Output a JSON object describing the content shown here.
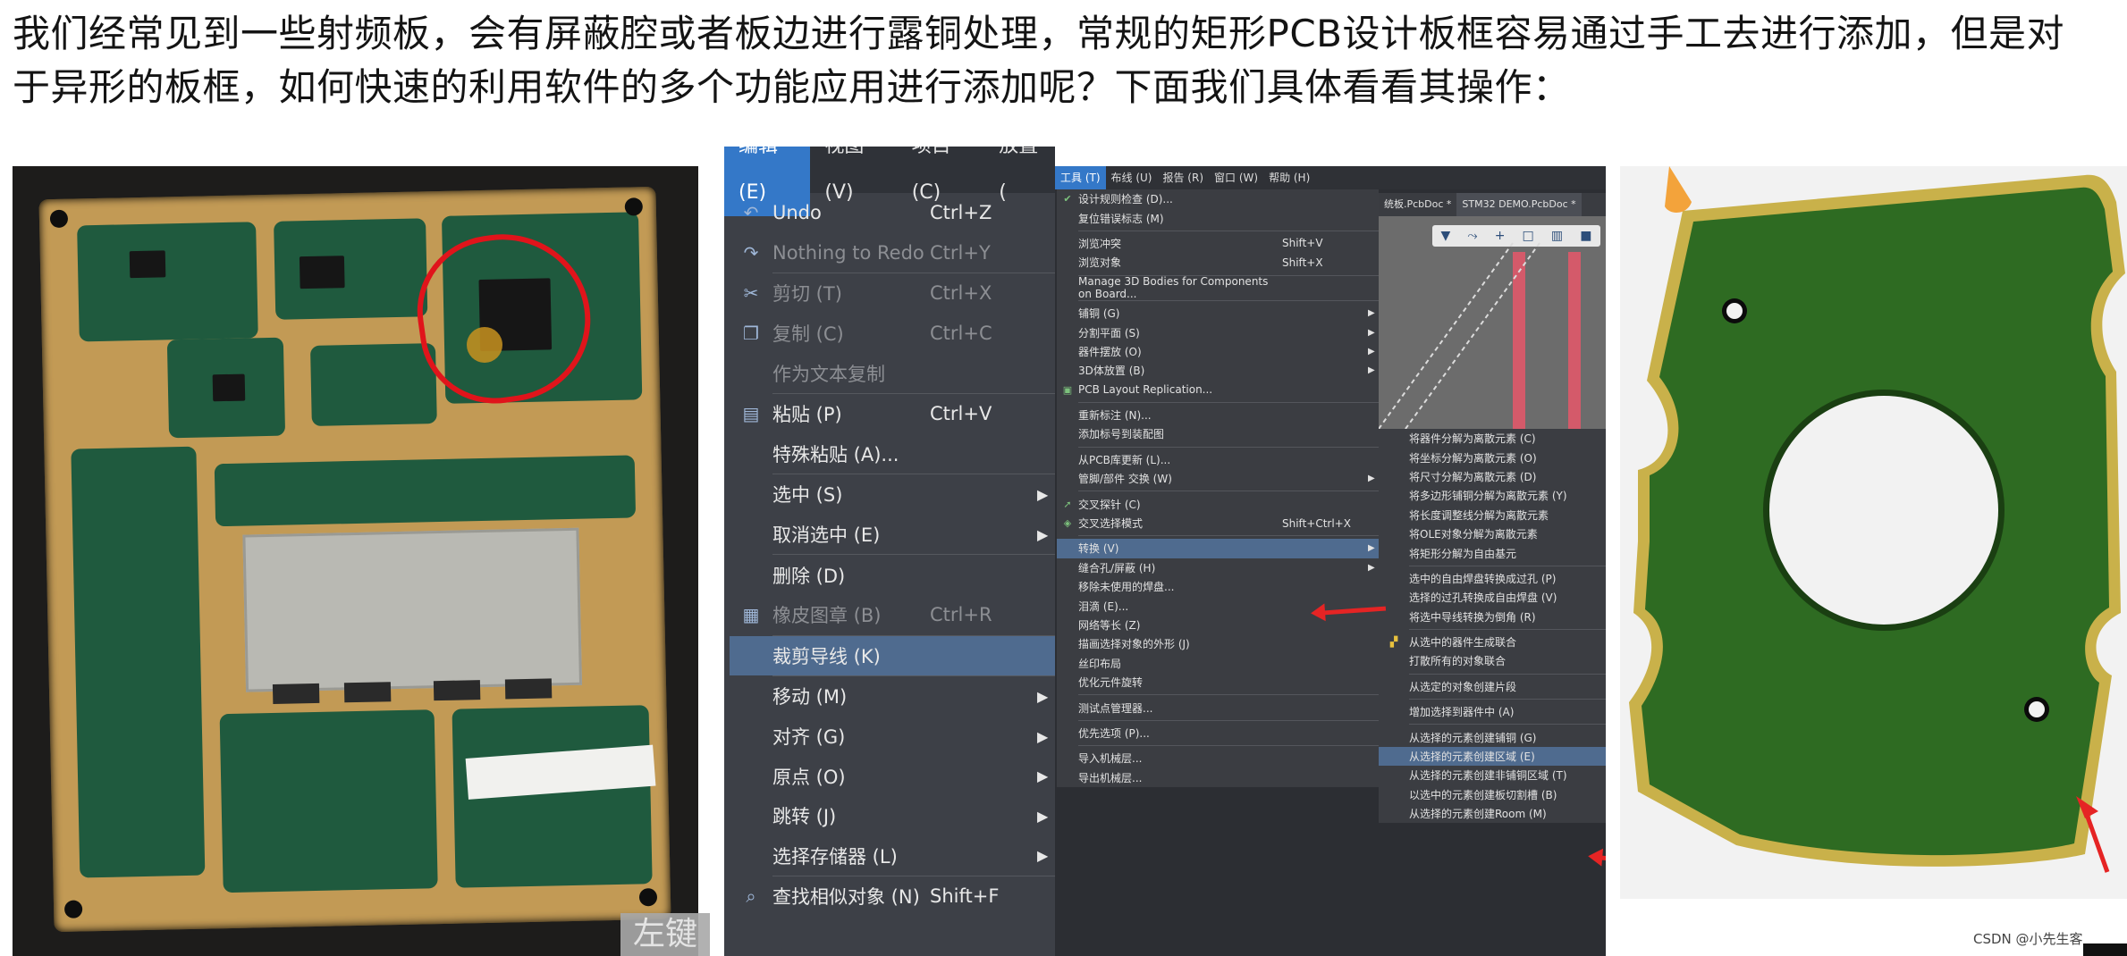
{
  "intro": {
    "line1": "我们经常见到一些射频板，会有屏蔽腔或者板边进行露铜处理，常规的矩形PCB设计板框容易通过手工去进行添加，但是对",
    "line2": "于异形的板框，如何快速的利用软件的多个功能应用进行添加呢？下面我们具体看看其操作："
  },
  "photo": {
    "watermark_button": "左键"
  },
  "edit_menu": {
    "menubar": [
      "编辑 (E)",
      "视图 (V)",
      "项目 (C)",
      "放置 ("
    ],
    "items": [
      {
        "icon": "undo-icon",
        "label": "Undo",
        "shortcut": "Ctrl+Z",
        "disabled": false
      },
      {
        "icon": "redo-icon",
        "label": "Nothing to Redo",
        "shortcut": "Ctrl+Y",
        "disabled": true
      },
      {
        "icon": "cut-icon",
        "label": "剪切 (T)",
        "shortcut": "Ctrl+X",
        "disabled": true
      },
      {
        "icon": "copy-icon",
        "label": "复制 (C)",
        "shortcut": "Ctrl+C",
        "disabled": true
      },
      {
        "icon": "",
        "label": "作为文本复制",
        "shortcut": "",
        "disabled": true
      },
      {
        "icon": "paste-icon",
        "label": "粘贴 (P)",
        "shortcut": "Ctrl+V",
        "disabled": false
      },
      {
        "icon": "",
        "label": "特殊粘贴 (A)...",
        "shortcut": "",
        "disabled": false
      },
      {
        "icon": "",
        "label": "选中 (S)",
        "shortcut": "",
        "submenu": true
      },
      {
        "icon": "",
        "label": "取消选中 (E)",
        "shortcut": "",
        "submenu": true
      },
      {
        "icon": "",
        "label": "删除 (D)",
        "shortcut": "",
        "disabled": false
      },
      {
        "icon": "rubber-stamp-icon",
        "label": "橡皮图章 (B)",
        "shortcut": "Ctrl+R",
        "disabled": true
      },
      {
        "icon": "",
        "label": "裁剪导线 (K)",
        "shortcut": "",
        "highlighted": true
      },
      {
        "icon": "",
        "label": "移动 (M)",
        "shortcut": "",
        "submenu": true
      },
      {
        "icon": "",
        "label": "对齐 (G)",
        "shortcut": "",
        "submenu": true
      },
      {
        "icon": "",
        "label": "原点 (O)",
        "shortcut": "",
        "submenu": true
      },
      {
        "icon": "",
        "label": "跳转 (J)",
        "shortcut": "",
        "submenu": true
      },
      {
        "icon": "",
        "label": "选择存储器 (L)",
        "shortcut": "",
        "submenu": true
      },
      {
        "icon": "search-icon",
        "label": "查找相似对象 (N)",
        "shortcut": "Shift+F",
        "disabled": false
      }
    ]
  },
  "tools_menu": {
    "menubar": [
      "工具 (T)",
      "布线 (U)",
      "报告 (R)",
      "窗口 (W)",
      "帮助 (H)"
    ],
    "tabs": [
      "统板.PcbDoc *",
      "STM32 DEMO.PcbDoc *"
    ],
    "items": [
      {
        "icon": "drc-icon",
        "label": "设计规则检查 (D)...",
        "shortcut": ""
      },
      {
        "icon": "",
        "label": "复位错误标志 (M)",
        "shortcut": ""
      },
      {
        "sep": true
      },
      {
        "icon": "",
        "label": "浏览冲突",
        "shortcut": "Shift+V"
      },
      {
        "icon": "",
        "label": "浏览对象",
        "shortcut": "Shift+X"
      },
      {
        "sep": true
      },
      {
        "icon": "",
        "label": "Manage 3D Bodies for Components on Board...",
        "shortcut": ""
      },
      {
        "sep": true
      },
      {
        "icon": "",
        "label": "铺铜 (G)",
        "shortcut": "",
        "submenu": true
      },
      {
        "icon": "",
        "label": "分割平面 (S)",
        "shortcut": "",
        "submenu": true
      },
      {
        "icon": "",
        "label": "器件摆放 (O)",
        "shortcut": "",
        "submenu": true
      },
      {
        "icon": "",
        "label": "3D体放置 (B)",
        "shortcut": "",
        "submenu": true
      },
      {
        "icon": "replication-icon",
        "label": "PCB Layout Replication...",
        "shortcut": ""
      },
      {
        "sep": true
      },
      {
        "icon": "",
        "label": "重新标注 (N)...",
        "shortcut": ""
      },
      {
        "icon": "",
        "label": "添加标号到装配图",
        "shortcut": ""
      },
      {
        "sep": true
      },
      {
        "icon": "",
        "label": "从PCB库更新 (L)...",
        "shortcut": ""
      },
      {
        "icon": "",
        "label": "管脚/部件 交换 (W)",
        "shortcut": "",
        "submenu": true
      },
      {
        "sep": true
      },
      {
        "icon": "cross-probe-icon",
        "label": "交叉探针 (C)",
        "shortcut": ""
      },
      {
        "icon": "cross-select-icon",
        "label": "交叉选择模式",
        "shortcut": "Shift+Ctrl+X"
      },
      {
        "sep": true
      },
      {
        "icon": "",
        "label": "转换 (V)",
        "shortcut": "",
        "submenu": true,
        "highlighted": true
      },
      {
        "icon": "",
        "label": "缝合孔/屏蔽 (H)",
        "shortcut": "",
        "submenu": true
      },
      {
        "icon": "",
        "label": "移除未使用的焊盘...",
        "shortcut": ""
      },
      {
        "icon": "",
        "label": "泪滴 (E)...",
        "shortcut": ""
      },
      {
        "icon": "",
        "label": "网络等长 (Z)",
        "shortcut": ""
      },
      {
        "icon": "",
        "label": "描画选择对象的外形 (J)",
        "shortcut": ""
      },
      {
        "icon": "",
        "label": "丝印布局",
        "shortcut": ""
      },
      {
        "icon": "",
        "label": "优化元件旋转",
        "shortcut": ""
      },
      {
        "sep": true
      },
      {
        "icon": "",
        "label": "测试点管理器...",
        "shortcut": ""
      },
      {
        "sep": true
      },
      {
        "icon": "",
        "label": "优先选项 (P)...",
        "shortcut": ""
      },
      {
        "sep": true
      },
      {
        "icon": "",
        "label": "导入机械层...",
        "shortcut": ""
      },
      {
        "icon": "",
        "label": "导出机械层...",
        "shortcut": ""
      }
    ],
    "submenu": [
      {
        "icon": "",
        "label": "将器件分解为离散元素 (C)"
      },
      {
        "icon": "",
        "label": "将坐标分解为离散元素 (O)"
      },
      {
        "icon": "",
        "label": "将尺寸分解为离散元素 (D)"
      },
      {
        "icon": "",
        "label": "将多边形铺铜分解为离散元素 (Y)"
      },
      {
        "icon": "",
        "label": "将长度调整线分解为离散元素"
      },
      {
        "icon": "",
        "label": "将OLE对象分解为离散元素"
      },
      {
        "icon": "",
        "label": "将矩形分解为自由基元"
      },
      {
        "sep": true
      },
      {
        "icon": "",
        "label": "选中的自由焊盘转换成过孔 (P)"
      },
      {
        "icon": "",
        "label": "选择的过孔转换成自由焊盘 (V)"
      },
      {
        "icon": "",
        "label": "将选中导线转换为倒角 (R)"
      },
      {
        "sep": true
      },
      {
        "icon": "union-icon",
        "label": "从选中的器件生成联合"
      },
      {
        "icon": "",
        "label": "打散所有的对象联合"
      },
      {
        "sep": true
      },
      {
        "icon": "",
        "label": "从选定的对象创建片段"
      },
      {
        "sep": true
      },
      {
        "icon": "",
        "label": "增加选择到器件中 (A)"
      },
      {
        "sep": true
      },
      {
        "icon": "",
        "label": "从选择的元素创建铺铜 (G)"
      },
      {
        "icon": "",
        "label": "从选择的元素创建区域 (E)",
        "highlighted": true
      },
      {
        "icon": "",
        "label": "从选择的元素创建非铺铜区域 (T)"
      },
      {
        "icon": "",
        "label": "以选中的元素创建板切割槽 (B)"
      },
      {
        "icon": "",
        "label": "从选择的元素创建Room (M)"
      }
    ]
  },
  "credit": "CSDN @小先生客",
  "colors": {
    "menu_highlight": "#4f6b8f",
    "menubar_active": "#3478c8",
    "annotation_red": "#e52424",
    "board_green": "#2e6b22",
    "board_copper_edge": "#c9b14a"
  }
}
